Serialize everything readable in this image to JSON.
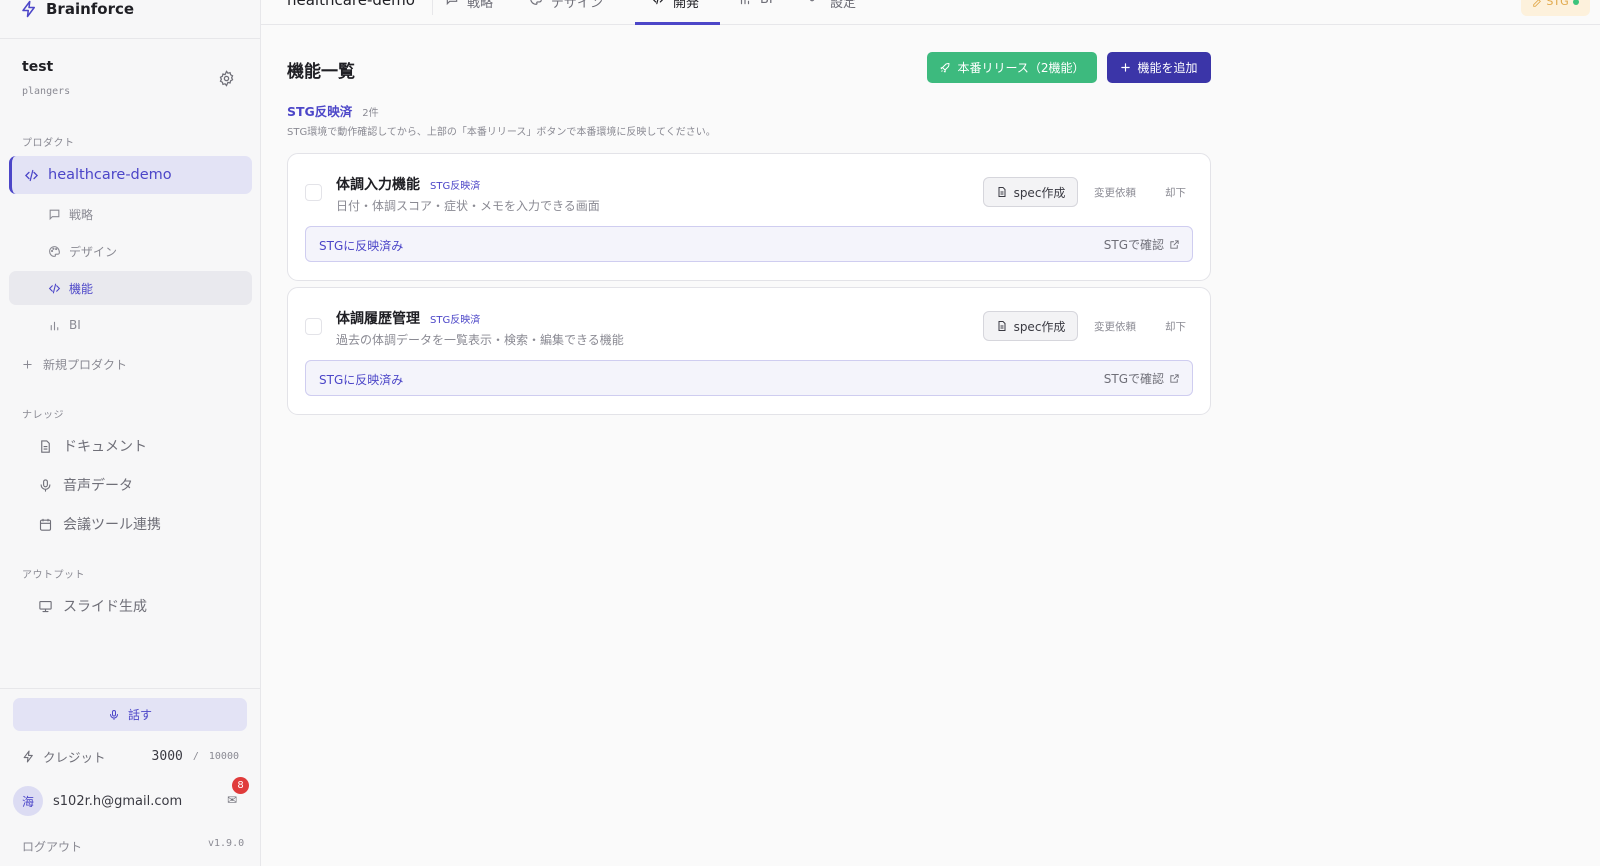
{
  "app": {
    "name": "Brainforce"
  },
  "workspace": {
    "name": "test",
    "org": "plangers"
  },
  "sidebar": {
    "section_products": "プロダクト",
    "project": "healthcare-demo",
    "project_nav": [
      {
        "label": "戦略",
        "icon": "chat-icon"
      },
      {
        "label": "デザイン",
        "icon": "palette-icon"
      },
      {
        "label": "機能",
        "icon": "code-icon",
        "active": true
      },
      {
        "label": "BI",
        "icon": "bar-chart-icon"
      }
    ],
    "new_project": "新規プロダクト",
    "section_knowledge": "ナレッジ",
    "knowledge_nav": [
      {
        "label": "ドキュメント",
        "icon": "document-icon"
      },
      {
        "label": "音声データ",
        "icon": "microphone-icon"
      },
      {
        "label": "会議ツール連携",
        "icon": "calendar-icon"
      }
    ],
    "section_output": "アウトプット",
    "output_nav": [
      {
        "label": "スライド生成",
        "icon": "presentation-icon"
      }
    ],
    "talk_button": "話す",
    "credit": {
      "label": "クレジット",
      "value": "3000",
      "separator": "/",
      "max": "10000"
    },
    "user": {
      "avatar": "海",
      "email": "s102r.h@gmail.com",
      "notifications": "8"
    },
    "logout": "ログアウト",
    "version": "v1.9.0"
  },
  "topbar": {
    "project_title": "healthcare-demo",
    "tabs": [
      {
        "label": "戦略",
        "icon": "chat-icon"
      },
      {
        "label": "デザイン",
        "icon": "palette-icon"
      },
      {
        "label": "開発",
        "icon": "code-icon",
        "active": true
      },
      {
        "label": "BI",
        "icon": "bar-chart-icon"
      },
      {
        "label": "設定",
        "icon": "settings-icon"
      }
    ],
    "env_badge": "STG"
  },
  "main": {
    "title": "機能一覧",
    "release_button": "本番リリース（2機能）",
    "add_button": "機能を追加",
    "section": {
      "title": "STG反映済",
      "count": "2件",
      "description": "STG環境で動作確認してから、上部の「本番リリース」ボタンで本番環境に反映してください。"
    },
    "features": [
      {
        "name": "体調入力機能",
        "tag": "STG反映済",
        "description": "日付・体調スコア・症状・メモを入力できる画面",
        "spec_button": "spec作成",
        "change_request": "変更依頼",
        "reject": "却下",
        "status": "STGに反映済み",
        "check_link": "STGで確認"
      },
      {
        "name": "体調履歴管理",
        "tag": "STG反映済",
        "description": "過去の体調データを一覧表示・検索・編集できる機能",
        "spec_button": "spec作成",
        "change_request": "変更依頼",
        "reject": "却下",
        "status": "STGに反映済み",
        "check_link": "STGで確認"
      }
    ]
  },
  "colors": {
    "accent": "#4c46c8",
    "release_green": "#3dba7e",
    "add_button": "#3b35a8",
    "notification_badge": "#e03b3b",
    "stg_badge_bg": "#fdf1dc"
  }
}
